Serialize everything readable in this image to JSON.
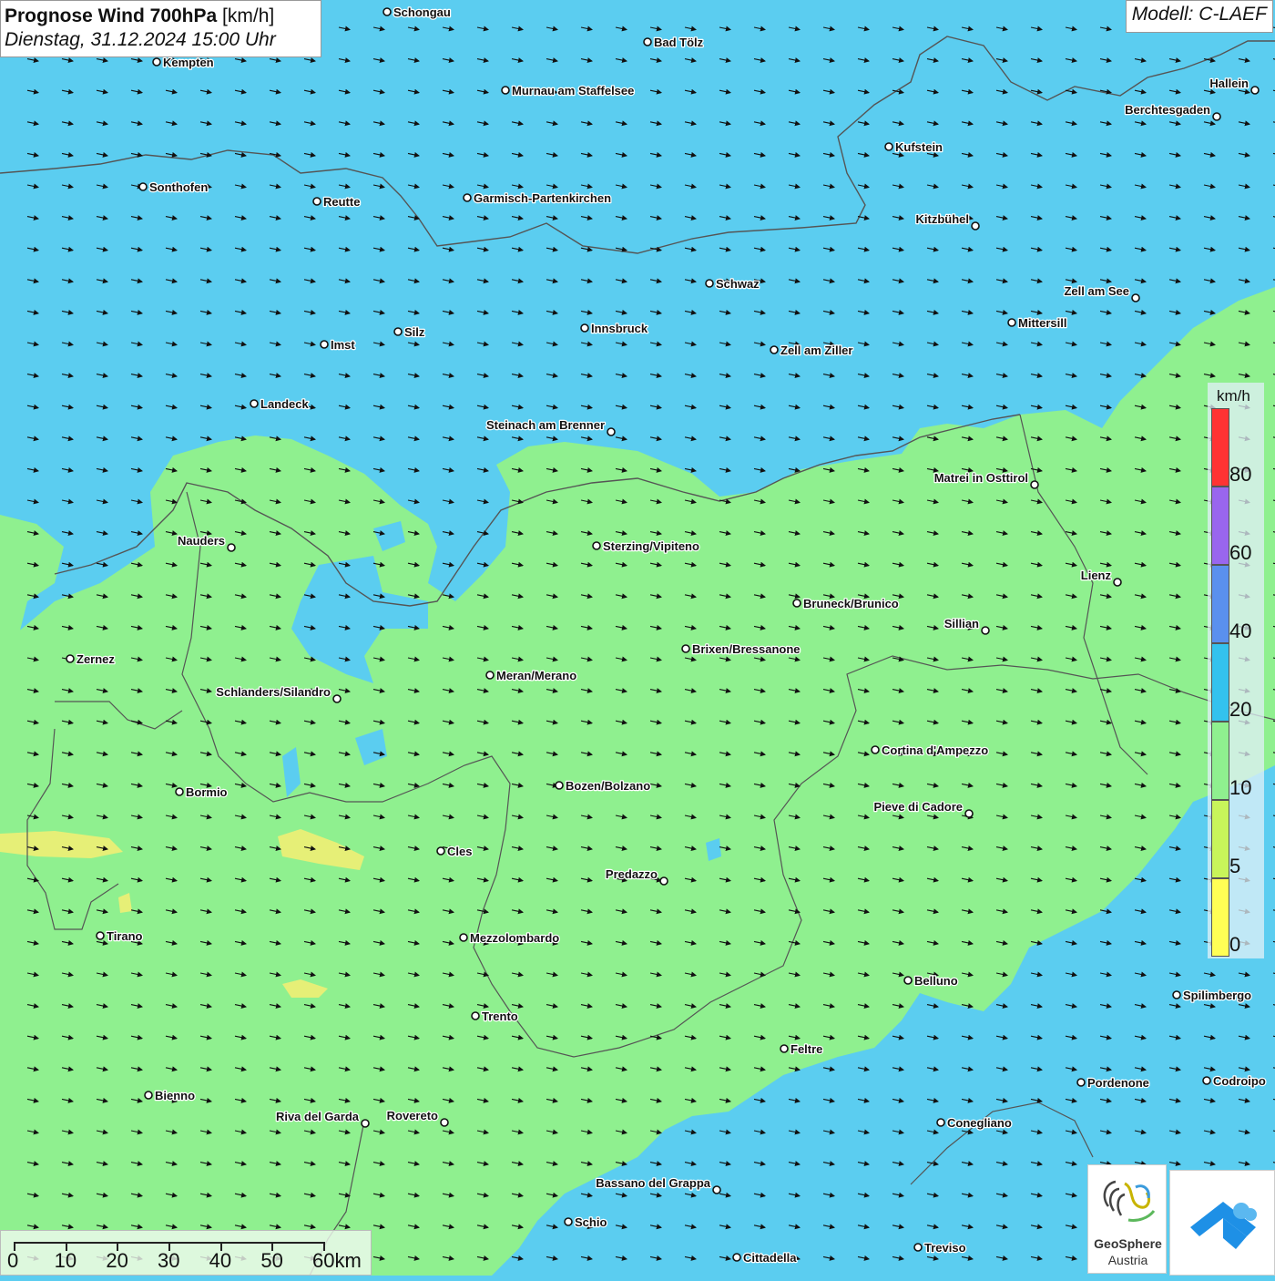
{
  "title": {
    "main": "Prognose Wind 700hPa",
    "unit": "[km/h]",
    "datetime": "Dienstag, 31.12.2024 15:00 Uhr"
  },
  "model": "Modell: C-LAEF",
  "legend": {
    "unit": "km/h",
    "ticks": [
      "0",
      "5",
      "10",
      "20",
      "40",
      "60",
      "80"
    ],
    "colors": [
      "#ffff55",
      "#c8f55a",
      "#8ff08f",
      "#33c2ee",
      "#5a90ee",
      "#9966ee",
      "#ff3333"
    ]
  },
  "scale_bar": {
    "labels": [
      "0",
      "10",
      "20",
      "30",
      "40",
      "50",
      "60km"
    ]
  },
  "logos": {
    "geosphere_name": "GeoSphere",
    "geosphere_sub": "Austria",
    "app_icon": "geosphere-warn-app-icon"
  },
  "colors": {
    "wind_10_20": "#8ff08f",
    "wind_20_40": "#5bcdf0",
    "wind_5_10": "#e6ef77",
    "border_line": "#555555",
    "arrow": "#111111"
  },
  "wind_direction": "west-northwest (arrows pointing east-southeast)",
  "cities": [
    "Schongau",
    "Bad Tölz",
    "Kempten",
    "Murnau am Staffelsee",
    "Hallein",
    "Berchtesgaden",
    "Kufstein",
    "Sonthofen",
    "Reutte",
    "Garmisch-Partenkirchen",
    "Kitzbühel",
    "Schwaz",
    "Zell am See",
    "Mittersill",
    "Silz",
    "Innsbruck",
    "Imst",
    "Zell am Ziller",
    "Landeck",
    "Steinach am Brenner",
    "Matrei in Osttirol",
    "Nauders",
    "Sterzing/Vipiteno",
    "Lienz",
    "Bruneck/Brunico",
    "Sillian",
    "Zernez",
    "Brixen/Bressanone",
    "Meran/Merano",
    "Schlanders/Silandro",
    "Cortina d'Ampezzo",
    "Bormio",
    "Bozen/Bolzano",
    "Pieve di Cadore",
    "Cles",
    "Predazzo",
    "Tirano",
    "Mezzolombardo",
    "Belluno",
    "Spilimbergo",
    "Trento",
    "Feltre",
    "Pordenone",
    "Codroipo",
    "Bienno",
    "Riva del Garda",
    "Rovereto",
    "Conegliano",
    "Bassano del Grappa",
    "Schio",
    "Treviso",
    "Cittadella"
  ]
}
